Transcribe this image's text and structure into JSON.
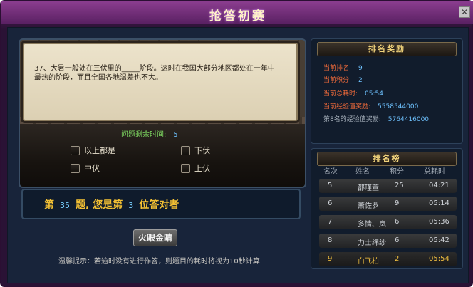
{
  "window": {
    "title": "抢答初赛",
    "close": "✕"
  },
  "question": {
    "text": "37、大暑一般处在三伏里的_____阶段。这时在我国大部分地区都处在一年中最热的阶段，而且全国各地温差也不大。",
    "timer_label": "问题剩余时间:",
    "timer_value": "5",
    "options": [
      "以上都是",
      "下伏",
      "中伏",
      "上伏"
    ]
  },
  "result": {
    "prefix": "第",
    "question_no": "35",
    "middle": "题, 您是第",
    "rank": "3",
    "suffix": "位答对者"
  },
  "eye_button": "火眼金睛",
  "tip": "温馨提示：若逾时没有进行作答，则题目的耗时将视为10秒计算",
  "reward": {
    "heading": "排名奖励",
    "rows": [
      {
        "label": "当前排名:",
        "value": "9"
      },
      {
        "label": "当前积分:",
        "value": "2"
      },
      {
        "label": "当前总耗时:",
        "value": "05:54"
      },
      {
        "label": "当前经验值奖励:",
        "value": "5558544000"
      },
      {
        "label": "第8名的经验值奖励:",
        "value": "5764416000"
      }
    ]
  },
  "leaderboard": {
    "heading": "排名榜",
    "columns": [
      "名次",
      "姓名",
      "积分",
      "总耗时"
    ],
    "rows": [
      {
        "rank": "5",
        "name": "邵瑾萱",
        "score": "25",
        "time": "04:21"
      },
      {
        "rank": "6",
        "name": "萧佐罗",
        "score": "9",
        "time": "05:14"
      },
      {
        "rank": "7",
        "name": "多情、岚",
        "score": "6",
        "time": "05:36"
      },
      {
        "rank": "8",
        "name": "力士绵纱",
        "score": "6",
        "time": "05:42"
      },
      {
        "rank": "9",
        "name": "白飞柏",
        "score": "2",
        "time": "05:54"
      }
    ]
  },
  "colors": {
    "accent_gold": "#f3c033",
    "value_blue": "#6ec2ff",
    "label_orange": "#f06a3a"
  }
}
